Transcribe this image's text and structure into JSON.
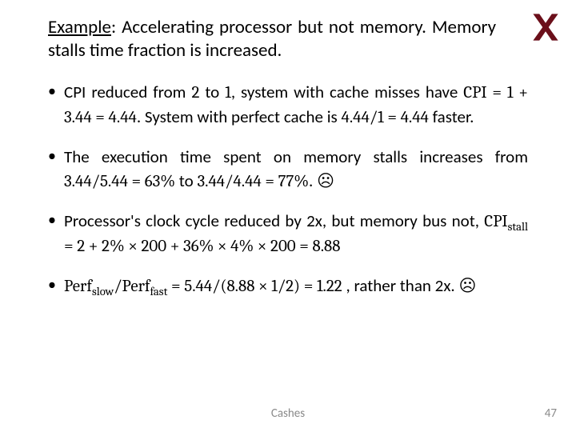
{
  "title": {
    "lead": "Example",
    "rest": ": Accelerating processor but not memory. Memory stalls time fraction is increased."
  },
  "bullets": {
    "b1_pre": "CPI reduced from ",
    "b1_m1": "2",
    "b1_mid1": " to ",
    "b1_m2": "1",
    "b1_mid2": ", system with cache misses have ",
    "b1_m3": "CPI = 1 + 3.44 = 4.44",
    "b1_mid3": ". System with perfect cache is ",
    "b1_m4": "4.44/1 = 4.44",
    "b1_post": " faster.",
    "b2_pre": "The execution time spent on memory stalls increases from ",
    "b2_m1": "3.44/5.44 = 63%",
    "b2_mid": " to ",
    "b2_m2": "3.44/4.44 = 77%",
    "b2_post": ". ☹",
    "b3_pre": "Processor's clock cycle reduced by 2x, but memory bus not, ",
    "b3_m1a": "CPI",
    "b3_m1b": "stall",
    "b3_m1c": " = 2 + 2% × 200 + 36% × 4% × 200 = 8.88",
    "b4_m1a": "Perf",
    "b4_m1b": "slow",
    "b4_m1c": "/Perf",
    "b4_m1d": "fast",
    "b4_m1e": " = 5.44/(8.88 × 1/2) = 1.22",
    "b4_post": " , rather than 2x. ☹"
  },
  "footer": {
    "center": "Cashes",
    "page": "47"
  },
  "logo": {
    "name": "technion-logo"
  }
}
